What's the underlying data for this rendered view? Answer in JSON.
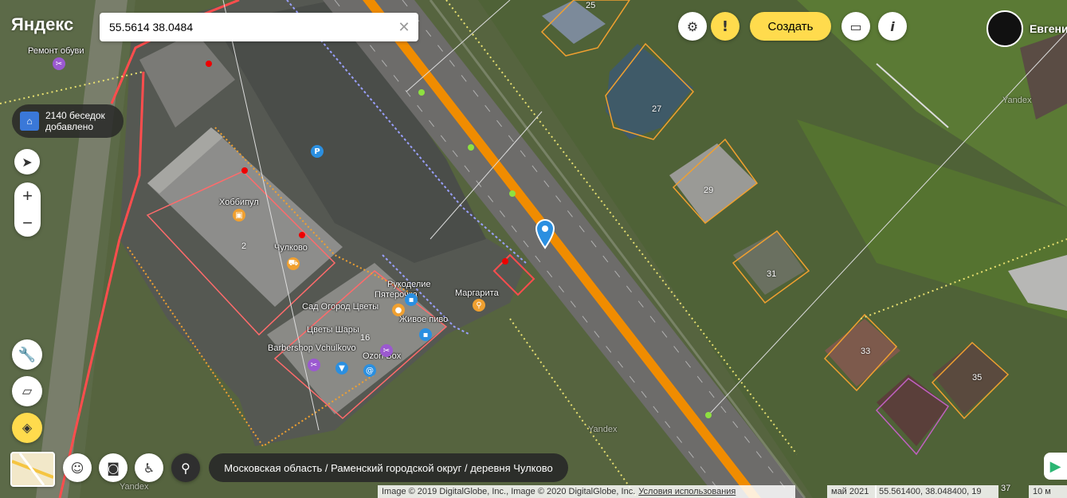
{
  "app": {
    "logo": "Яндекс"
  },
  "search": {
    "value": "55.5614 38.0484",
    "clear_icon": "close-icon"
  },
  "header": {
    "create_label": "Создать",
    "user_name": "Евгени"
  },
  "promo": {
    "text_line1": "2140 беседок",
    "text_line2": "добавлено"
  },
  "zoom": {
    "in": "+",
    "out": "−"
  },
  "address_bar": {
    "text": "Московская область / Раменский городской округ / деревня Чулково"
  },
  "attribution": {
    "images": "Image © 2019 DigitalGlobe, Inc., Image © 2020 DigitalGlobe, Inc.",
    "terms": "Условия использования",
    "date": "май 2021",
    "coords": "55.561400, 38.048400, 19",
    "scale": "10 м"
  },
  "map_labels": {
    "repair": "Ремонт обуви",
    "hobbipul": "Хоббипул",
    "chulkovo": "Чулково",
    "rukodelie": "Рукоделие",
    "pyaterochka": "Пятёрочка",
    "sad": "Сад Огород Цветы",
    "margarita": "Маргарита",
    "pivo": "Живое пиво",
    "cvety": "Цветы Шары",
    "barbershop": "Barbershop Vchulkovo",
    "ozon": "Ozon Box",
    "yandex": "Yandex"
  },
  "house_numbers": [
    "25",
    "27",
    "29",
    "31",
    "33",
    "35",
    "37",
    "2",
    "16"
  ],
  "colors": {
    "road": "#f08c00",
    "accent": "#ffdb4d",
    "cadastre": "#ff4d4d",
    "pin": "#2b8fe0"
  }
}
